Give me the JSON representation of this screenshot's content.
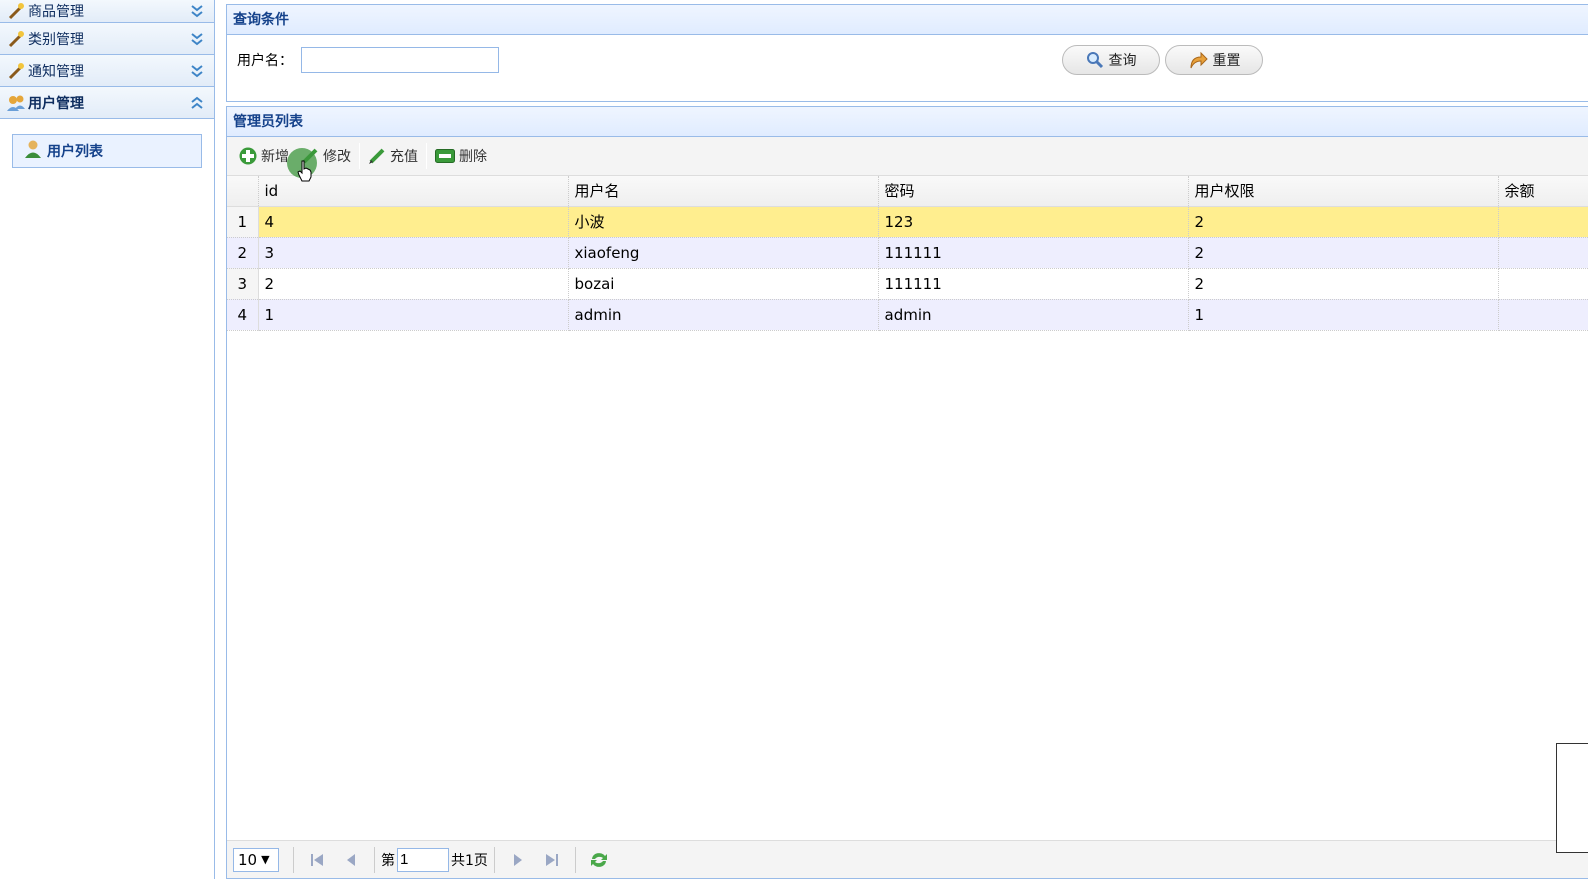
{
  "sidebar": {
    "sections": [
      {
        "label": "商品管理",
        "icon": "wand-icon"
      },
      {
        "label": "类别管理",
        "icon": "wand-icon"
      },
      {
        "label": "通知管理",
        "icon": "wand-icon"
      },
      {
        "label": "用户管理",
        "icon": "users-icon"
      }
    ],
    "items": [
      {
        "label": "用户列表",
        "icon": "user-icon"
      }
    ]
  },
  "query": {
    "title": "查询条件",
    "username_label": "用户名：",
    "username_value": "",
    "search_label": "查询",
    "reset_label": "重置"
  },
  "list": {
    "title": "管理员列表",
    "toolbar": {
      "add": "新增",
      "edit": "修改",
      "recharge": "充值",
      "delete": "删除"
    },
    "columns": [
      "id",
      "用户名",
      "密码",
      "用户权限",
      "余额"
    ],
    "rows": [
      {
        "rownum": "1",
        "id": "4",
        "username": "小波",
        "password": "123",
        "role": "2",
        "balance": ""
      },
      {
        "rownum": "2",
        "id": "3",
        "username": "xiaofeng",
        "password": "111111",
        "role": "2",
        "balance": ""
      },
      {
        "rownum": "3",
        "id": "2",
        "username": "bozai",
        "password": "111111",
        "role": "2",
        "balance": ""
      },
      {
        "rownum": "4",
        "id": "1",
        "username": "admin",
        "password": "admin",
        "role": "1",
        "balance": ""
      }
    ],
    "selected_row": 0
  },
  "pager": {
    "page_size": "10",
    "page_prefix": "第",
    "page_number": "1",
    "page_total": "共1页"
  },
  "colors": {
    "accent": "#15428b",
    "border": "#99bbe8",
    "selected_row": "#ffee8f",
    "alt_row": "#eeeefe"
  }
}
